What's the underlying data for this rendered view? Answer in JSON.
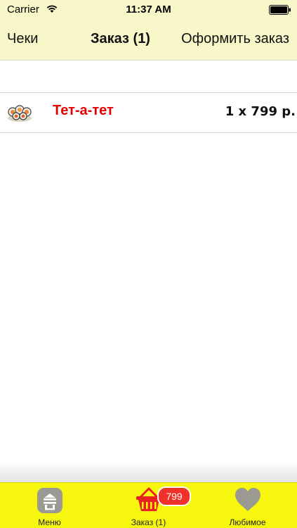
{
  "status_bar": {
    "carrier": "Carrier",
    "time": "11:37 AM"
  },
  "nav": {
    "left_button": "Чеки",
    "title": "Заказ (1)",
    "right_button": "Оформить заказ"
  },
  "order_items": [
    {
      "name": "Тет-а-тет",
      "quantity_price": "1 x 799 р.",
      "thumbnail": "sushi-roll-icon"
    }
  ],
  "tab_bar": {
    "tabs": [
      {
        "label": "Меню",
        "icon": "menu-food-icon"
      },
      {
        "label": "Заказ (1)",
        "icon": "basket-icon",
        "badge": "799"
      },
      {
        "label": "Любимое",
        "icon": "heart-icon"
      }
    ]
  },
  "colors": {
    "nav_background": "#f7f7c9",
    "tab_bar_background": "#f6f60f",
    "item_name": "#e30000",
    "badge": "#f0302b",
    "basket": "#e8231f"
  }
}
